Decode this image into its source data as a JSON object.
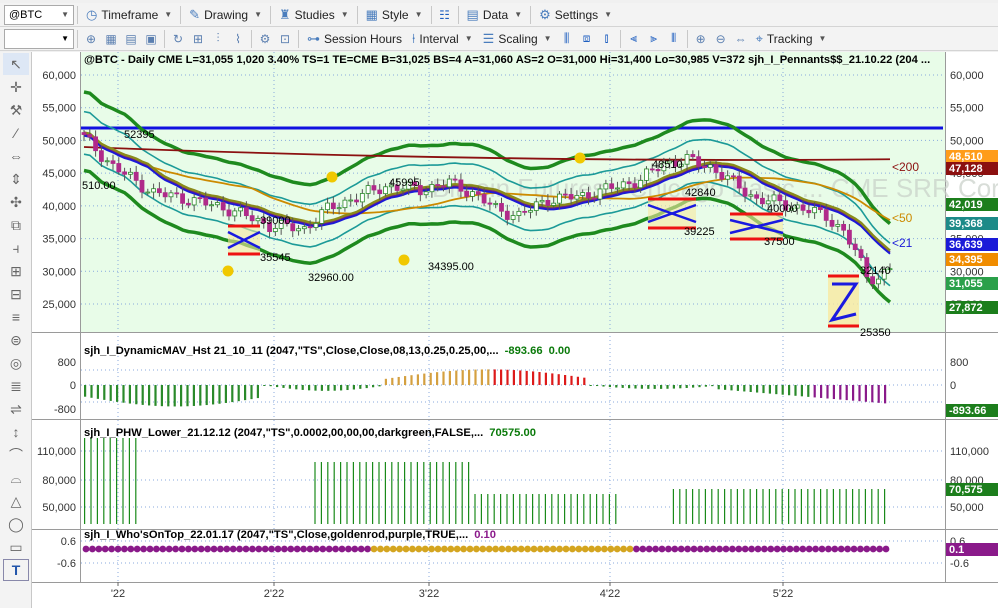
{
  "toolbar1": {
    "symbol": "@BTC",
    "items": [
      {
        "id": "timeframe",
        "label": "Timeframe",
        "icon": "clock-icon",
        "glyph": "◷"
      },
      {
        "id": "drawing",
        "label": "Drawing",
        "icon": "pencil-icon",
        "glyph": "✎"
      },
      {
        "id": "studies",
        "label": "Studies",
        "icon": "flask-icon",
        "glyph": "♜"
      },
      {
        "id": "style",
        "label": "Style",
        "icon": "chart-style-icon",
        "glyph": "▦"
      },
      {
        "id": "data",
        "label": "Data",
        "icon": "data-icon",
        "glyph": "▤"
      },
      {
        "id": "settings",
        "label": "Settings",
        "icon": "gear-icon",
        "glyph": "⚙"
      }
    ]
  },
  "toolbar2": {
    "session_hours": "Session Hours",
    "interval": "Interval",
    "scaling": "Scaling",
    "tracking": "Tracking"
  },
  "chart": {
    "header": "@BTC - Daily  CME  L=31,055  1,020  3.40%  TS=1  TE=CME  B=31,025  BS=4  A=31,060  AS=2  O=31,000  Hi=31,400  Lo=30,985  V=372  sjh_I_Pennants$$_21.10.22 (204 ...",
    "watermark": "Bitcoin Futures - Chicago Basic ... CME SRR Corp",
    "price_ticks": [
      "60,000",
      "55,000",
      "50,000",
      "45,000",
      "40,000",
      "35,000",
      "30,000",
      "25,000"
    ],
    "x_labels": [
      "'22",
      "2'22",
      "3'22",
      "4'22",
      "5'22"
    ],
    "annotations": [
      "52395",
      "510.00",
      "45995",
      "48510",
      "42840",
      "39000",
      "35545",
      "32960.00",
      "34395.00",
      "39225",
      "40000",
      "37500",
      "32140",
      "25350"
    ],
    "ma_labels": {
      "ma200": "<200",
      "ma50": "<50",
      "ma21": "<21"
    },
    "ma_colors": {
      "ma200": "#8b1010",
      "ma50": "#cc8a00",
      "ma21": "#1a1ad8"
    },
    "price_badges": [
      {
        "text": "48,510",
        "color": "#ff9c1a"
      },
      {
        "text": "47,128",
        "color": "#8b1010"
      },
      {
        "text": "42,019",
        "color": "#1c7e1c"
      },
      {
        "text": "39,368",
        "color": "#1c8a88"
      },
      {
        "text": "36,639",
        "color": "#1a1ad8"
      },
      {
        "text": "34,395",
        "color": "#f08c00"
      },
      {
        "text": "31,055",
        "color": "#2aa04a"
      },
      {
        "text": "27,872",
        "color": "#1c7e1c"
      }
    ]
  },
  "ind1": {
    "label": "sjh_I_DynamicMAV_Hst 21_10_11 (2047,\"TS\",Close,Close,08,13,0.25,0.25,00,...",
    "value1": "-893.66",
    "value2": "0.00",
    "ticks": [
      "800",
      "0",
      "-800"
    ],
    "badge": "-893.66"
  },
  "ind2": {
    "label": "sjh_I_PHW_Lower_21.12.12 (2047,\"TS\",0.0002,00,00,00,darkgreen,FALSE,...",
    "value": "70575.00",
    "ticks": [
      "110,000",
      "80,000",
      "50,000"
    ],
    "badge": "70,575"
  },
  "ind3": {
    "label": "sjh_I_Who'sOnTop_22.01.17 (2047,\"TS\",Close,goldenrod,purple,TRUE,...",
    "value": "0.10",
    "ticks": [
      "0.6",
      "-0.6"
    ],
    "badge": "0.1"
  }
}
